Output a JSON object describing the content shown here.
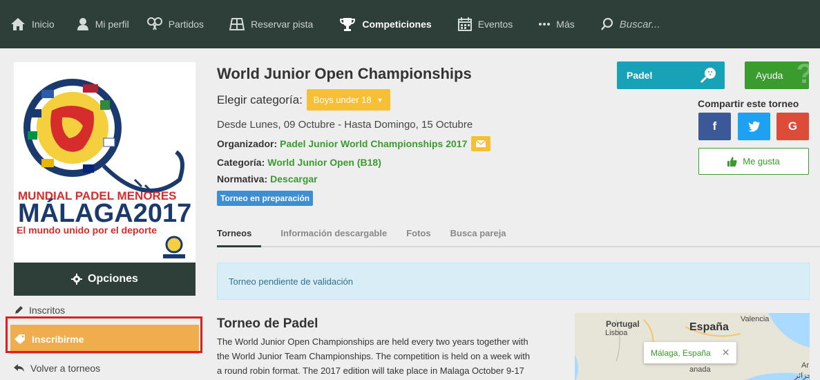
{
  "nav": {
    "items": [
      {
        "label": "Inicio",
        "icon": "home-icon"
      },
      {
        "label": "Mi perfil",
        "icon": "user-icon"
      },
      {
        "label": "Partidos",
        "icon": "rackets-icon"
      },
      {
        "label": "Reservar pista",
        "icon": "court-icon"
      },
      {
        "label": "Competiciones",
        "icon": "trophy-icon"
      },
      {
        "label": "Eventos",
        "icon": "calendar-icon"
      },
      {
        "label": "Más",
        "icon": "dots-icon"
      }
    ],
    "search_placeholder": "Buscar..."
  },
  "logo": {
    "line1": "MUNDIAL PADEL MENORES",
    "line2": "MÁLAGA2017",
    "line3": "El mundo unido por el deporte"
  },
  "sidebar": {
    "options_label": "Opciones",
    "links": [
      {
        "label": "Inscritos",
        "icon": "pencil-icon"
      },
      {
        "label": "Inscribirme",
        "icon": "tag-icon"
      },
      {
        "label": "Volver a torneos",
        "icon": "reply-icon"
      }
    ]
  },
  "tournament": {
    "title": "World Junior Open Championships",
    "category_label": "Elegir categoría:",
    "category_selected": "Boys under 18",
    "dates": "Desde Lunes, 09 Octubre - Hasta Domingo, 15 Octubre",
    "organizer_label": "Organizador:",
    "organizer": "Padel Junior World Championships 2017",
    "category_field_label": "Categoría:",
    "category_value": "World Junior Open (B18)",
    "rules_label": "Normativa:",
    "rules_link": "Descargar",
    "status": "Torneo en preparación"
  },
  "tabs": [
    "Torneos",
    "Información descargable",
    "Fotos",
    "Busca pareja"
  ],
  "alert": "Torneo pendiente de validación",
  "section": {
    "title": "Torneo de Padel",
    "lines": [
      "The World Junior Open Championships are held every two years together with",
      "the World Junior Team Championships. The competition is held on a week with",
      "a round robin format. The 2017 edition will take place in Malaga October 9-17"
    ]
  },
  "map": {
    "labels": [
      "Portugal",
      "Lisboa",
      "España",
      "Valencia",
      "Ar",
      "الجزائر",
      "anada"
    ],
    "popup": "Málaga, España",
    "close": "✕"
  },
  "right": {
    "padel_label": "Padel",
    "help_label": "Ayuda",
    "help_glyph": "?",
    "share_label": "Compartir este torneo",
    "facebook": "f",
    "google": "G",
    "like_label": "Me gusta"
  },
  "colors": {
    "nav_bg": "#2e3e38",
    "accent_orange": "#f0ad4e",
    "select_yellow": "#f7bf36",
    "green": "#3a9b2e",
    "teal": "#17a2b8",
    "facebook": "#3b5998",
    "twitter": "#1da1f2",
    "google": "#dd4b39",
    "badge_blue": "#3d8ed3"
  }
}
